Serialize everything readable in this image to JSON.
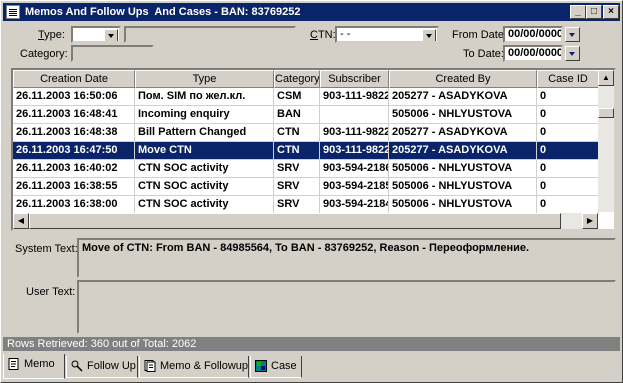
{
  "window": {
    "title": "Memos And Follow Ups  And Cases - BAN: 83769252",
    "controls": [
      "_",
      "□",
      "×"
    ]
  },
  "filters": {
    "type_label": "Type:",
    "type_value": "",
    "ctn_label": "CTN:",
    "ctn_value": "-  -",
    "category_label": "Category:",
    "category_value": "",
    "from_date_label": "From Date:",
    "from_date_value": "00/00/0000",
    "to_date_label": "To Date:",
    "to_date_value": "00/00/0000"
  },
  "grid": {
    "columns": [
      "Creation Date",
      "Type",
      "Category",
      "Subscriber",
      "Created By",
      "Case ID"
    ],
    "rows": [
      [
        "26.11.2003 16:50:06",
        "Пом. SIM по жел.кл.",
        "CSM",
        "903-111-9822",
        "205277 - ASADYKOVA",
        "0"
      ],
      [
        "26.11.2003 16:48:41",
        "Incoming enquiry",
        "BAN",
        "",
        "505006 - NHLYUSTOVA",
        "0"
      ],
      [
        "26.11.2003 16:48:38",
        "Bill Pattern Changed",
        "CTN",
        "903-111-9822",
        "205277 - ASADYKOVA",
        "0"
      ],
      [
        "26.11.2003 16:47:50",
        "Move CTN",
        "CTN",
        "903-111-9822",
        "205277 - ASADYKOVA",
        "0"
      ],
      [
        "26.11.2003 16:40:02",
        "CTN SOC activity",
        "SRV",
        "903-594-2186",
        "505006 - NHLYUSTOVA",
        "0"
      ],
      [
        "26.11.2003 16:38:55",
        "CTN SOC activity",
        "SRV",
        "903-594-2185",
        "505006 - NHLYUSTOVA",
        "0"
      ],
      [
        "26.11.2003 16:38:00",
        "CTN SOC activity",
        "SRV",
        "903-594-2184",
        "505006 - NHLYUSTOVA",
        "0"
      ]
    ],
    "selected_row": 3
  },
  "details": {
    "system_text_label": "System Text:",
    "system_text_value": "Move of CTN:  From BAN -  84985564,  To BAN -  83769252,  Reason -  Переоформление.",
    "user_text_label": "User Text:",
    "user_text_value": ""
  },
  "status": {
    "text": "Rows Retrieved: 360 out of Total: 2062"
  },
  "tabs": [
    {
      "label": "Memo",
      "icon": "memo-icon",
      "active": true
    },
    {
      "label": "Follow Up",
      "icon": "follow-up-icon",
      "active": false
    },
    {
      "label": "Memo & Followup",
      "icon": "memo-followup-icon",
      "active": false
    },
    {
      "label": "Case",
      "icon": "case-icon",
      "active": false
    }
  ]
}
